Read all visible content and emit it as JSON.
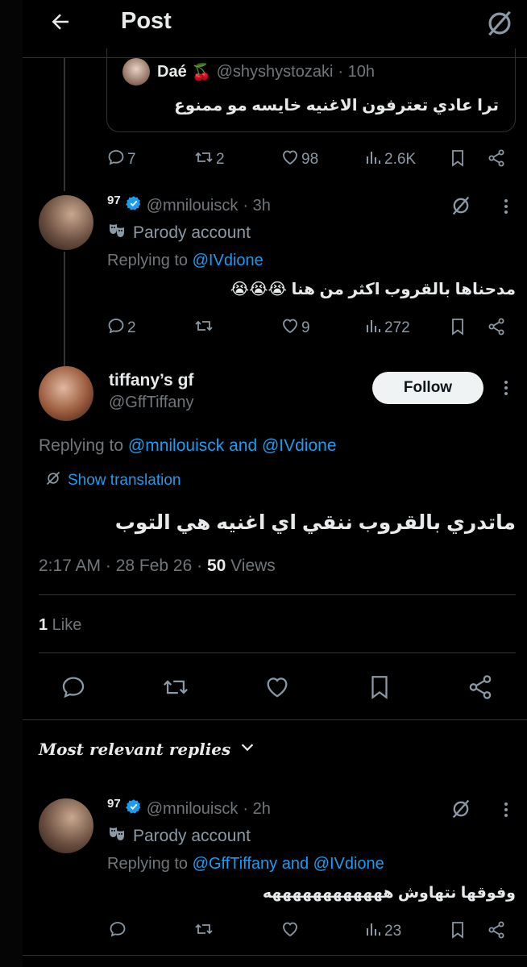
{
  "header": {
    "title": "Post"
  },
  "quoted": {
    "name": "Daé",
    "emoji": "🍒",
    "handle": "@shyshystozaki",
    "time": "· 10h",
    "text": "ترا عادي تعترفون الاغنيه خايسه مو ممنوع"
  },
  "quoted_stats": {
    "replies": "7",
    "reposts": "2",
    "likes": "98",
    "views": "2.6K"
  },
  "reply1": {
    "name": "97",
    "handle": "@mnilouisck",
    "time": "· 3h",
    "parody": "Parody account",
    "replying_prefix": "Replying to",
    "replying_to": "@IVdione",
    "text": "مدحناها بالقروب اكثر من هنا 😭😭😭",
    "stats": {
      "replies": "2",
      "reposts": "",
      "likes": "9",
      "views": "272"
    }
  },
  "main": {
    "name": "tiffany’s gf",
    "handle": "@GffTiffany",
    "follow_label": "Follow",
    "replying_prefix": "Replying to",
    "replying_to": "@mnilouisck and @IVdione",
    "show_translation": "Show translation",
    "text": "ماتدري بالقروب ننقي اي اغنيه هي التوب",
    "time": "2:17 AM · 28 Feb 26 · ",
    "views_count": "50",
    "views_label": " Views",
    "likes_count": "1",
    "likes_label": " Like"
  },
  "sort": {
    "label": "Most relevant replies"
  },
  "reply2": {
    "name": "97",
    "handle": "@mnilouisck",
    "time": "· 2h",
    "parody": "Parody account",
    "replying_prefix": "Replying to",
    "replying_to": "@GffTiffany and @IVdione",
    "text": "وفوقها نتهاوش ههههههههههههه",
    "stats": {
      "views": "23"
    }
  },
  "colors": {
    "accent": "#1d9bf0",
    "background": "#000000",
    "muted": "#71767b",
    "verified": "#1d9bf0"
  },
  "icons": [
    "back-arrow-icon",
    "grok-icon",
    "reply-icon",
    "repost-icon",
    "like-icon",
    "views-icon",
    "bookmark-icon",
    "share-icon",
    "verified-icon",
    "parody-mask-icon",
    "more-icon",
    "translate-icon",
    "chevron-down-icon"
  ]
}
